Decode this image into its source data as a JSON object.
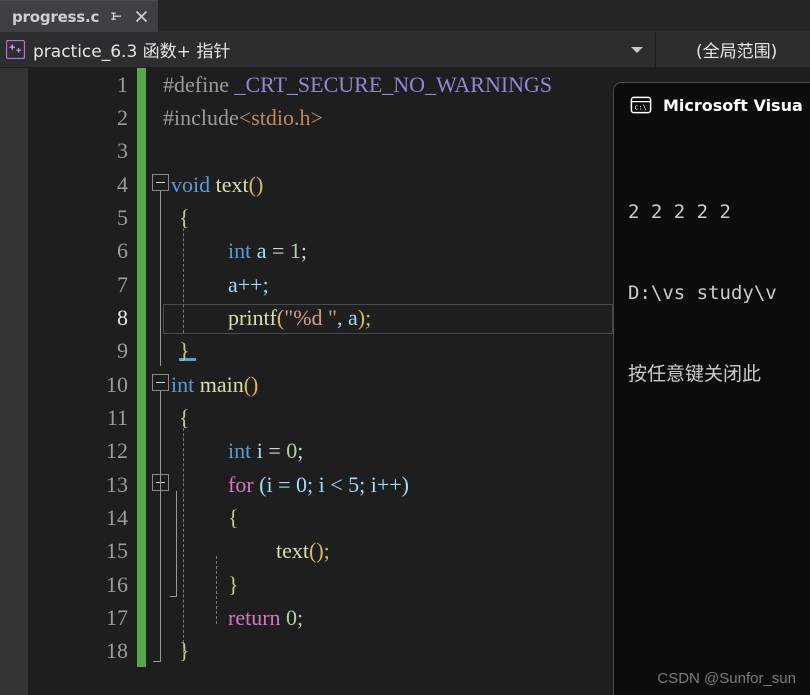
{
  "tab": {
    "filename": "progress.c",
    "pin_icon": "pin-icon",
    "close_icon": "close-icon"
  },
  "navbar": {
    "project_icon": "cpp-project-icon",
    "project_label": "practice_6.3 函数+ 指针",
    "dropdown_icon": "chevron-down-icon",
    "scope_label": "(全局范围)"
  },
  "editor": {
    "lines": [
      {
        "n": "1",
        "indent": 0,
        "current": false
      },
      {
        "n": "2",
        "indent": 0,
        "current": false
      },
      {
        "n": "3",
        "indent": 0,
        "current": false
      },
      {
        "n": "4",
        "indent": 0,
        "current": false
      },
      {
        "n": "5",
        "indent": 0,
        "current": false
      },
      {
        "n": "6",
        "indent": 0,
        "current": false
      },
      {
        "n": "7",
        "indent": 0,
        "current": false
      },
      {
        "n": "8",
        "indent": 0,
        "current": true
      },
      {
        "n": "9",
        "indent": 0,
        "current": false
      },
      {
        "n": "10",
        "indent": 0,
        "current": false
      },
      {
        "n": "11",
        "indent": 0,
        "current": false
      },
      {
        "n": "12",
        "indent": 0,
        "current": false
      },
      {
        "n": "13",
        "indent": 0,
        "current": false
      },
      {
        "n": "14",
        "indent": 0,
        "current": false
      },
      {
        "n": "15",
        "indent": 0,
        "current": false
      },
      {
        "n": "16",
        "indent": 0,
        "current": false
      },
      {
        "n": "17",
        "indent": 0,
        "current": false
      },
      {
        "n": "18",
        "indent": 0,
        "current": false
      }
    ],
    "code": {
      "l1": "#define _CRT_SECURE_NO_WARNINGS",
      "l2": "#include<stdio.h>",
      "l3": "",
      "l4": "void text()",
      "l5": "{",
      "l6": "    int a = 1;",
      "l7": "    a++;",
      "l8": "    printf(\"%d \", a);",
      "l9": "}",
      "l10": "int main()",
      "l11": "{",
      "l12": "    int i = 0;",
      "l13": "    for (i = 0; i < 5; i++)",
      "l14": "    {",
      "l15": "        text();",
      "l16": "    }",
      "l17": "    return 0;",
      "l18": "}"
    },
    "tokens": {
      "define": "#define",
      "macro_name": "_CRT_SECURE_NO_WARNINGS",
      "include": "#include",
      "lt": "<",
      "stdio": "stdio.h",
      "gt": ">",
      "void": "void",
      "text_fn": "text",
      "parens": "()",
      "open_brace": "{",
      "close_brace": "}",
      "int": "int",
      "var_a": "a",
      "eq": " = ",
      "one": "1",
      "semi": ";",
      "a_inc": "a++;",
      "printf": "printf",
      "lparen": "(",
      "fmt_string": "\"%d \"",
      "comma_a": ", a",
      "rparen_semi": ");",
      "main_fn": "main",
      "var_i": "i",
      "zero": "0",
      "for": "for",
      "for_init": " (i = 0; i < 5; i++)",
      "text_call": "text",
      "call_semi": "();",
      "return": "return",
      "return_zero": " 0;"
    },
    "change_bar_color": "#57a64a",
    "current_line_color": "#4a4a4a"
  },
  "console": {
    "icon": "terminal-icon",
    "title": "Microsoft Visua",
    "output": [
      "2 2 2 2 2",
      "D:\\vs study\\v",
      "按任意键关闭此"
    ]
  },
  "watermark": {
    "text": "CSDN @Sunfor_sun"
  }
}
